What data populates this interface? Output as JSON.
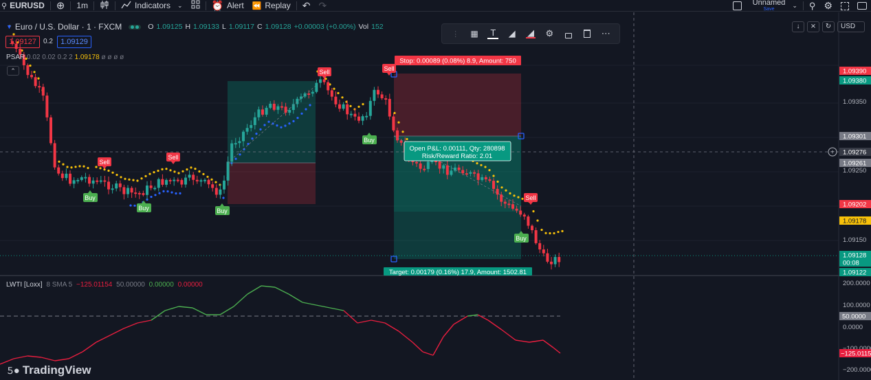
{
  "toolbar": {
    "symbol": "EURUSD",
    "interval": "1m",
    "indicators_label": "Indicators",
    "alert_label": "Alert",
    "replay_label": "Replay",
    "layout_name": "Unnamed",
    "layout_status": "Save"
  },
  "legend": {
    "title": "Euro / U.S. Dollar · 1 · FXCM",
    "o_label": "O",
    "o_value": "1.09125",
    "h_label": "H",
    "h_value": "1.09133",
    "l_label": "L",
    "l_value": "1.09117",
    "c_label": "C",
    "c_value": "1.09128",
    "change": "+0.00003 (+0.00%)",
    "vol_label": "Vol",
    "vol_value": "152",
    "bid": "1.09127",
    "spread": "0.2",
    "ask": "1.09129"
  },
  "psar": {
    "label": "PSAR",
    "params": "0.02 0.02 0.2 2",
    "value": "1.09178",
    "extras": "ø ø ø ø"
  },
  "currency": "USD",
  "positions": {
    "stop_label": "Stop: 0.00089 (0.08%) 8.9, Amount: 750",
    "target_label": "Target: 0.00179 (0.16%) 17.9, Amount: 1502.81",
    "open_pl": "Open P&L: 0.00111, Qty: 280898",
    "rr": "Risk/Reward Ratio: 2.01"
  },
  "signals": {
    "sell": "Sell",
    "buy": "Buy"
  },
  "price_axis": {
    "ticks": [
      "1.09350",
      "1.09250",
      "1.09150"
    ],
    "badges": [
      {
        "text": "1.09390",
        "color": "#f23645"
      },
      {
        "text": "1.09380",
        "color": "#089981"
      },
      {
        "text": "1.09301",
        "color": "#787b86"
      },
      {
        "text": "1.09276",
        "color": "#131722"
      },
      {
        "text": "1.09261",
        "color": "#787b86"
      },
      {
        "text": "1.09202",
        "color": "#f23645"
      },
      {
        "text": "1.09178",
        "color": "#f7c10a"
      },
      {
        "text": "1.09128",
        "color": "#089981"
      },
      {
        "text": "00:08",
        "color": "#089981"
      },
      {
        "text": "1.09122",
        "color": "#089981"
      }
    ]
  },
  "lwti": {
    "name": "LWTI [Loxx]",
    "params": "8 SMA 5",
    "value": "−125.01154",
    "v2": "50.00000",
    "v3": "0.00000",
    "v4": "0.00000",
    "axis_ticks": [
      "200.0000",
      "100.0000",
      "0.0000",
      "−100.0000",
      "−200.0000"
    ],
    "midline_badge": "50.0000",
    "current_badge": "−125.0115"
  },
  "brand": "TradingView",
  "colors": {
    "up": "#26a69a",
    "down": "#f23645",
    "psar_dot_down": "#f7c10a",
    "psar_dot_up": "#2962ff",
    "lwti_up": "#4caf50",
    "lwti_down": "#e91e3f"
  }
}
